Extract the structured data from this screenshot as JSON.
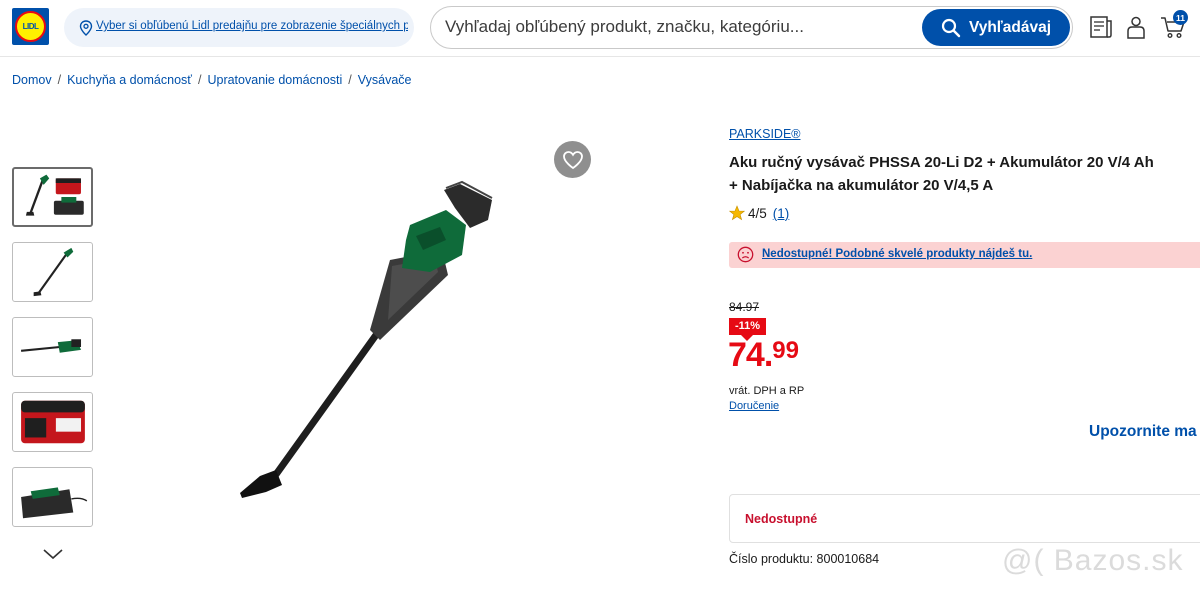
{
  "header": {
    "logo_text": "LIDL",
    "store_selector": "Vyber si obľúbenú Lidl predajňu pre zobrazenie špeciálnych ponúk",
    "search_placeholder": "Vyhľadaj obľúbený produkt, značku, kategóriu...",
    "search_button": "Vyhľadávaj",
    "cart_count": "11",
    "icons": [
      "store-pin-icon",
      "search-icon",
      "leaflet-icon",
      "account-icon",
      "cart-icon"
    ],
    "brand_color": "#0050aa"
  },
  "breadcrumb": {
    "items": [
      "Domov",
      "Kuchyňa a domácnosť",
      "Upratovanie domácnosti",
      "Vysávače"
    ]
  },
  "gallery": {
    "thumbnails": [
      "vacuum-with-battery-and-charger",
      "vacuum-full",
      "vacuum-side",
      "battery",
      "charger"
    ],
    "active_index": 0
  },
  "product": {
    "brand": "PARKSIDE®",
    "title_line1": "Aku ručný vysávač PHSSA 20-Li D2 + Akumulátor 20 V/4 Ah",
    "title_line2": "+ Nabíjačka na akumulátor 20 V/4,5 A",
    "rating": "4/5",
    "review_count": "(1)",
    "alert": "Nedostupné! Podobné skvelé produkty nájdeš tu.",
    "old_price": "84.97",
    "discount": "-11%",
    "price_int": "74.",
    "price_dec": "99",
    "vat_note": "vrát. DPH a RP",
    "delivery": "Doručenie",
    "notify": "Upozornite ma",
    "availability": "Nedostupné",
    "product_number": "Číslo produktu: 800010684",
    "price_color": "#e60a14"
  },
  "watermark": "@( Bazos.sk"
}
